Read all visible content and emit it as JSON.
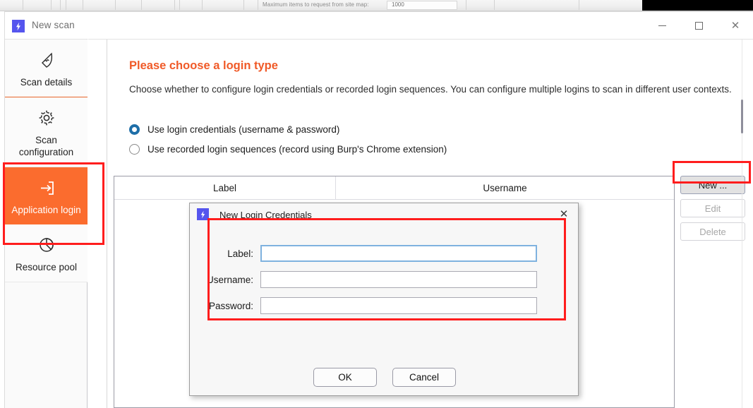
{
  "background_app": {
    "setting_label": "Maximum items to request from site map:",
    "setting_value": "1000"
  },
  "window": {
    "title": "New scan",
    "app_icon": "burp-bolt-icon",
    "controls": {
      "minimize": "—",
      "maximize": "□",
      "close": "✕"
    }
  },
  "sidebar": {
    "items": [
      {
        "label": "Scan details",
        "icon": "radar-icon",
        "active": false
      },
      {
        "label": "Scan configuration",
        "icon": "gear-icon",
        "active": false
      },
      {
        "label": "Application login",
        "icon": "login-arrow-icon",
        "active": true
      },
      {
        "label": "Resource pool",
        "icon": "pie-chart-icon",
        "active": false
      }
    ]
  },
  "main": {
    "title": "Please choose a login type",
    "description": "Choose whether to configure login credentials or recorded login sequences. You can configure multiple logins to scan in different user contexts.",
    "options": [
      {
        "label": "Use login credentials (username & password)",
        "selected": true
      },
      {
        "label": "Use recorded login sequences (record using Burp's Chrome extension)",
        "selected": false
      }
    ],
    "table": {
      "columns": [
        "Label",
        "Username"
      ],
      "rows": []
    },
    "buttons": [
      {
        "label": "New ...",
        "state": "hover"
      },
      {
        "label": "Edit",
        "state": "disabled"
      },
      {
        "label": "Delete",
        "state": "disabled"
      }
    ]
  },
  "dialog": {
    "title": "New Login Credentials",
    "icon": "burp-bolt-icon",
    "close_glyph": "✕",
    "fields": [
      {
        "label": "Label:",
        "value": "",
        "placeholder": "",
        "focused": true
      },
      {
        "label": "Username:",
        "value": "",
        "placeholder": "",
        "focused": false
      },
      {
        "label": "Password:",
        "value": "",
        "placeholder": "",
        "focused": false
      }
    ],
    "ok_label": "OK",
    "cancel_label": "Cancel"
  },
  "colors": {
    "accent_orange": "#fb6c2e",
    "title_orange": "#f05a28",
    "radio_blue": "#1e6ea8",
    "annotation_red": "#ff1d1d",
    "burp_purple": "#5555ee"
  }
}
